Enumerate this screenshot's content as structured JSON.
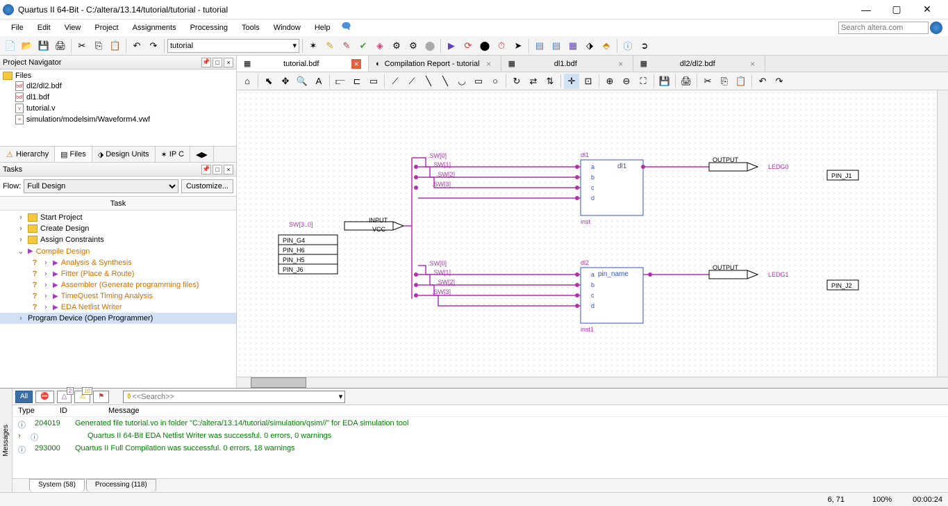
{
  "title": "Quartus II 64-Bit - C:/altera/13.14/tutorial/tutorial - tutorial",
  "menu": [
    "File",
    "Edit",
    "View",
    "Project",
    "Assignments",
    "Processing",
    "Tools",
    "Window",
    "Help"
  ],
  "search_placeholder": "Search altera.com",
  "toolbar_project": "tutorial",
  "navigator": {
    "title": "Project Navigator",
    "root": "Files",
    "files": [
      "dl2/dl2.bdf",
      "dl1.bdf",
      "tutorial.v",
      "simulation/modelsim/Waveform4.vwf"
    ],
    "tabs": [
      "Hierarchy",
      "Files",
      "Design Units",
      "IP C"
    ]
  },
  "tasks": {
    "title": "Tasks",
    "flow_label": "Flow:",
    "flow_value": "Full Design",
    "customize": "Customize...",
    "header": "Task",
    "items": [
      {
        "label": "Start Project",
        "indent": 1,
        "folder": true
      },
      {
        "label": "Create Design",
        "indent": 1,
        "folder": true
      },
      {
        "label": "Assign Constraints",
        "indent": 1,
        "folder": true
      },
      {
        "label": "Compile Design",
        "indent": 1,
        "play": true,
        "orange": true,
        "expanded": true
      },
      {
        "label": "Analysis & Synthesis",
        "indent": 2,
        "play": true,
        "orange": true,
        "q": true
      },
      {
        "label": "Fitter (Place & Route)",
        "indent": 2,
        "play": true,
        "orange": true,
        "q": true
      },
      {
        "label": "Assembler (Generate programming files)",
        "indent": 2,
        "play": true,
        "orange": true,
        "q": true
      },
      {
        "label": "TimeQuest Timing Analysis",
        "indent": 2,
        "play": true,
        "orange": true,
        "q": true
      },
      {
        "label": "EDA Netlist Writer",
        "indent": 2,
        "play": true,
        "orange": true,
        "q": true
      },
      {
        "label": "Program Device (Open Programmer)",
        "indent": 1,
        "sel": true
      }
    ]
  },
  "doc_tabs": [
    {
      "label": "tutorial.bdf",
      "active": true
    },
    {
      "label": "Compilation Report - tutorial"
    },
    {
      "label": "dl1.bdf"
    },
    {
      "label": "dl2/dl2.bdf"
    }
  ],
  "schematic": {
    "input_bus": "SW[3..0]",
    "net_labels": [
      ".SW[0]",
      ".SW[1]",
      ".SW[2]",
      ".SW[3]"
    ],
    "pin_table": [
      "PIN_G4",
      "PIN_H6",
      "PIN_H5",
      "PIN_J6"
    ],
    "block1": {
      "name": "dl1",
      "out": "dl1",
      "inst": "inst",
      "pins": [
        "a",
        "b",
        "c",
        "d"
      ]
    },
    "block2": {
      "name": "dl2",
      "out": "pin_name",
      "inst": "inst1",
      "pins": [
        "a",
        "b",
        "c",
        "d"
      ]
    },
    "output1": {
      "port": "OUTPUT",
      "name": "LEDG0",
      "pin": "PIN_J1"
    },
    "output2": {
      "port": "OUTPUT",
      "name": "LEDG1",
      "pin": "PIN_J2"
    },
    "vcc": "INPUT\nVCC"
  },
  "messages": {
    "filters": {
      "all": "All",
      "err": "⛔",
      "warn": "△",
      "warn2": "△",
      "flag": "🚩"
    },
    "badge_warn": "2",
    "badge_info": "10",
    "search": "<<Search>>",
    "columns": [
      "Type",
      "ID",
      "Message"
    ],
    "rows": [
      {
        "id": "204019",
        "text": "Generated file tutorial.vo in folder \"C:/altera/13.14/tutorial/simulation/qsim//\" for EDA simulation tool"
      },
      {
        "id": "",
        "text": "Quartus II 64-Bit EDA Netlist Writer was successful. 0 errors, 0 warnings"
      },
      {
        "id": "293000",
        "text": "Quartus II Full Compilation was successful. 0 errors, 18 warnings"
      }
    ],
    "tabs": [
      "System (58)",
      "Processing (118)"
    ]
  },
  "status": {
    "pos": "6, 71",
    "zoom": "100%",
    "time": "00:00:24"
  }
}
